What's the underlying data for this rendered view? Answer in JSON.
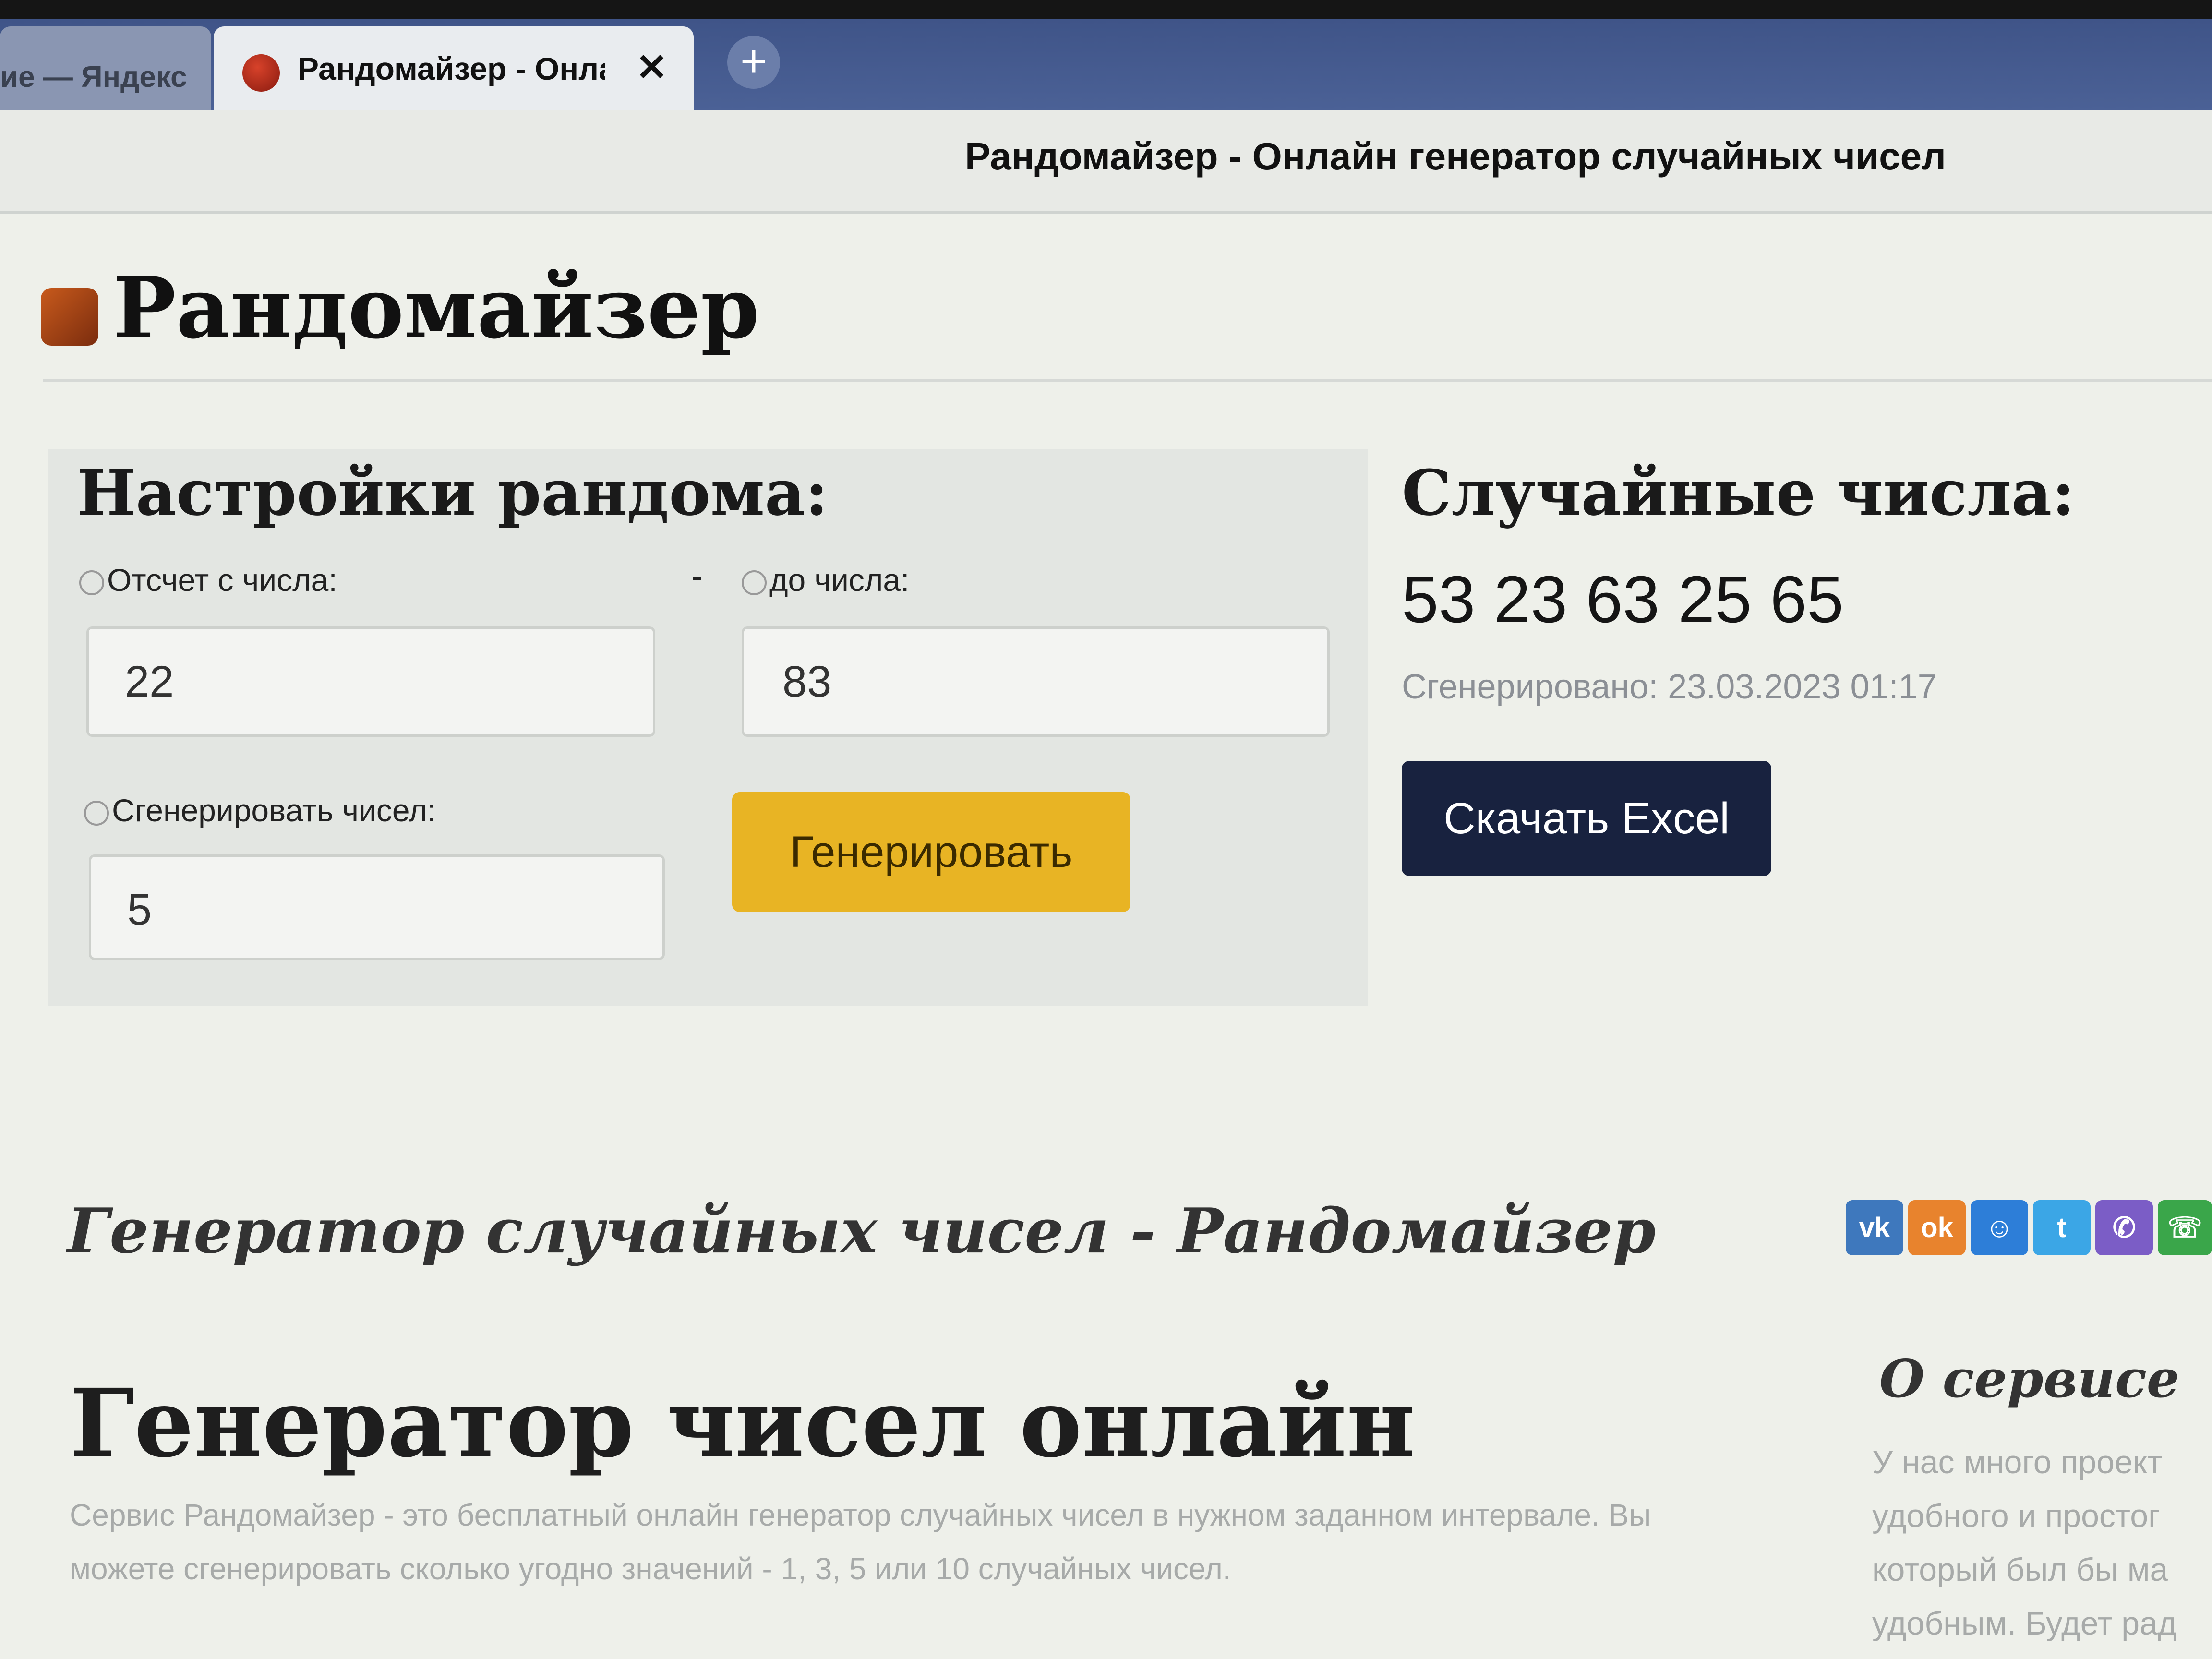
{
  "browser": {
    "prev_tab_title": "ие — Яндекс",
    "active_tab_title": "Рандомайзер - Онлайн",
    "close_glyph": "✕",
    "new_tab_glyph": "+",
    "window_title": "Рандомайзер - Онлайн генератор случайных чисел"
  },
  "site": {
    "title": "Рандомайзер"
  },
  "settings": {
    "title": "Настройки рандома:",
    "from_label": "Отсчет с числа:",
    "dash": "-",
    "to_label": "до числа:",
    "from_value": "22",
    "to_value": "83",
    "count_label": "Сгенерировать чисел:",
    "count_value": "5",
    "generate_button": "Генерировать"
  },
  "results": {
    "title": "Случайные числа:",
    "numbers": "53 23 63 25 65",
    "generated_at": "Сгенерировано: 23.03.2023 01:17",
    "excel_button": "Скачать Excel"
  },
  "section_heading": "Генератор случайных чисел - Рандомайзер",
  "share": {
    "vk": "vk",
    "ok": "ok",
    "mm": "☺",
    "tw": "t",
    "vb": "✆",
    "wa": "☏"
  },
  "article": {
    "heading": "Генератор чисел онлайн",
    "intro": "Сервис Рандомайзер - это бесплатный онлайн генератор случайных чисел в нужном заданном интервале. Вы можете сгенерировать сколько угодно значений - 1, 3, 5 или 10 случайных чисел."
  },
  "about": {
    "title": "О сервисе",
    "lines": [
      "У нас много проект",
      "удобного и простог",
      "который был бы ма",
      "удобным. Будет рад"
    ]
  },
  "colors": {
    "accent_button": "#e8b424",
    "dark_button": "#18223f",
    "tabstrip": "#4b6196"
  }
}
